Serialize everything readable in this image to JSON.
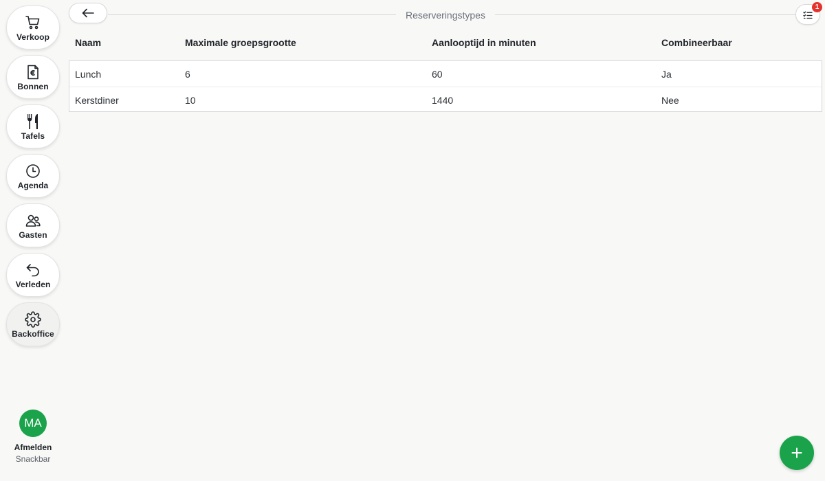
{
  "sidebar": {
    "items": [
      {
        "label": "Verkoop",
        "icon": "cart-icon"
      },
      {
        "label": "Bonnen",
        "icon": "receipt-euro-icon"
      },
      {
        "label": "Tafels",
        "icon": "cutlery-icon"
      },
      {
        "label": "Agenda",
        "icon": "clock-icon"
      },
      {
        "label": "Gasten",
        "icon": "users-icon"
      },
      {
        "label": "Verleden",
        "icon": "undo-arrow-icon"
      },
      {
        "label": "Backoffice",
        "icon": "gear-icon",
        "active": true
      }
    ],
    "user": {
      "initials": "MA",
      "logout_label": "Afmelden",
      "role": "Snackbar",
      "avatar_color": "#1aa34a"
    }
  },
  "header": {
    "title": "Reserveringstypes",
    "notification_count": "1"
  },
  "table": {
    "columns": [
      "Naam",
      "Maximale groepsgrootte",
      "Aanlooptijd in minuten",
      "Combineerbaar"
    ],
    "rows": [
      [
        "Lunch",
        "6",
        "60",
        "Ja"
      ],
      [
        "Kerstdiner",
        "10",
        "1440",
        "Nee"
      ]
    ]
  },
  "colors": {
    "accent": "#1aa34a",
    "badge": "#e5322d",
    "background": "#f8f8f7"
  }
}
